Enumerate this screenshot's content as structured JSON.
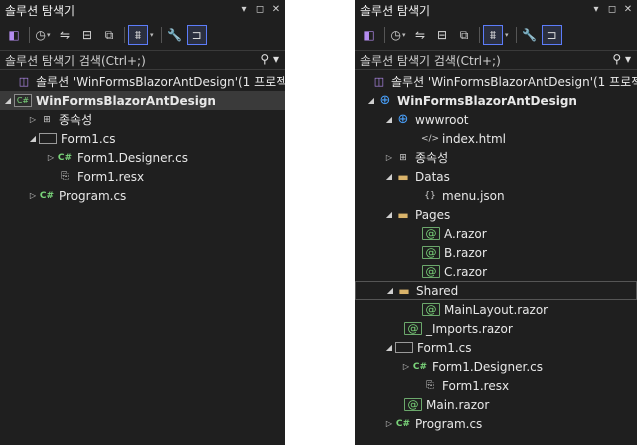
{
  "left": {
    "title": "솔루션 탐색기",
    "search_placeholder": "솔루션 탐색기 검색(Ctrl+;)",
    "solution_label": "솔루션 'WinFormsBlazorAntDesign'(1 프로젝",
    "tree": [
      {
        "label": "WinFormsBlazorAntDesign",
        "icon": "csharp-project-icon",
        "expander": "open",
        "bold": true,
        "selected": true
      },
      {
        "label": "종속성",
        "icon": "dependencies-icon",
        "expander": "closed"
      },
      {
        "label": "Form1.cs",
        "icon": "form-icon",
        "expander": "open"
      },
      {
        "label": "Form1.Designer.cs",
        "icon": "csharp-file-icon",
        "expander": "closed"
      },
      {
        "label": "Form1.resx",
        "icon": "resx-icon",
        "expander": "none"
      },
      {
        "label": "Program.cs",
        "icon": "csharp-file-icon",
        "expander": "closed"
      }
    ]
  },
  "right": {
    "title": "솔루션 탐색기",
    "search_placeholder": "솔루션 탐색기 검색(Ctrl+;)",
    "solution_label": "솔루션 'WinFormsBlazorAntDesign'(1 프로젝",
    "tree": [
      {
        "label": "WinFormsBlazorAntDesign",
        "icon": "web-project-icon",
        "expander": "open",
        "bold": true
      },
      {
        "label": "wwwroot",
        "icon": "globe-icon",
        "expander": "open"
      },
      {
        "label": "index.html",
        "icon": "html-file-icon",
        "expander": "none"
      },
      {
        "label": "종속성",
        "icon": "dependencies-icon",
        "expander": "closed"
      },
      {
        "label": "Datas",
        "icon": "folder-icon",
        "expander": "open"
      },
      {
        "label": "menu.json",
        "icon": "json-file-icon",
        "expander": "none"
      },
      {
        "label": "Pages",
        "icon": "folder-icon",
        "expander": "open"
      },
      {
        "label": "A.razor",
        "icon": "razor-file-icon",
        "expander": "none"
      },
      {
        "label": "B.razor",
        "icon": "razor-file-icon",
        "expander": "none"
      },
      {
        "label": "C.razor",
        "icon": "razor-file-icon",
        "expander": "none"
      },
      {
        "label": "Shared",
        "icon": "folder-icon",
        "expander": "open",
        "highlighted": true
      },
      {
        "label": "MainLayout.razor",
        "icon": "razor-file-icon",
        "expander": "none"
      },
      {
        "label": "_Imports.razor",
        "icon": "razor-file-icon",
        "expander": "none"
      },
      {
        "label": "Form1.cs",
        "icon": "form-icon",
        "expander": "open"
      },
      {
        "label": "Form1.Designer.cs",
        "icon": "csharp-file-icon",
        "expander": "closed"
      },
      {
        "label": "Form1.resx",
        "icon": "resx-icon",
        "expander": "none"
      },
      {
        "label": "Main.razor",
        "icon": "razor-file-icon",
        "expander": "none"
      },
      {
        "label": "Program.cs",
        "icon": "csharp-file-icon",
        "expander": "closed"
      }
    ]
  },
  "icons": {
    "pin": "pin-icon",
    "close": "close-icon",
    "dropdown": "dropdown-icon",
    "search": "search-icon"
  },
  "colors": {
    "panel_bg": "#1f1f1f",
    "selection_bg": "#3a3a3a",
    "active_tool_border": "#5c7cfa",
    "csharp_green": "#7bd67b",
    "web_blue": "#4aa3ff",
    "folder_yellow": "#d9b36a"
  }
}
